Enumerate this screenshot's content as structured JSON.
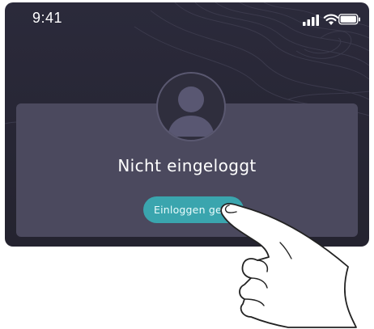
{
  "status_bar": {
    "time": "9:41",
    "icons": [
      "cellular-signal-icon",
      "wifi-icon",
      "battery-icon"
    ]
  },
  "profile": {
    "status_text": "Nicht eingeloggt",
    "avatar_icon": "user-placeholder-icon"
  },
  "actions": {
    "login_label": "Einloggen gehen"
  },
  "colors": {
    "background": "#2b2a3b",
    "card": "#4b495e",
    "button": "#3aa5ae",
    "text": "#ffffff"
  }
}
